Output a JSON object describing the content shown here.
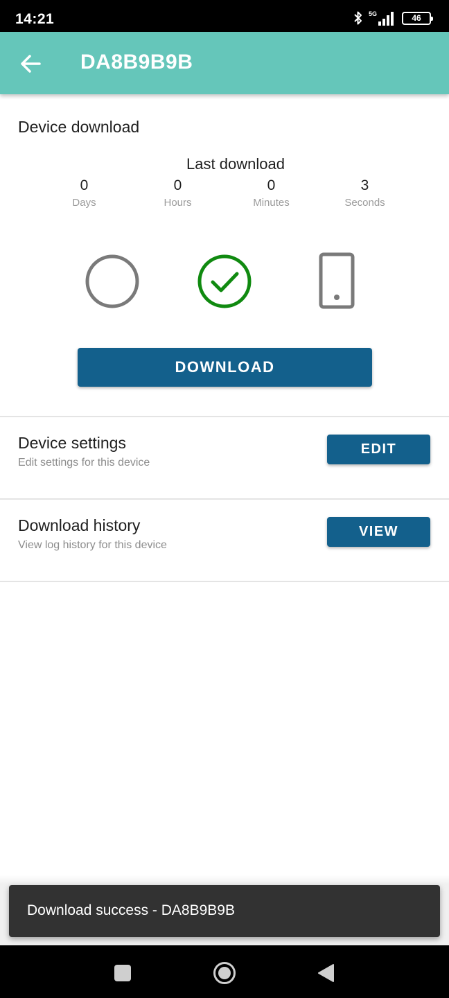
{
  "status_bar": {
    "time": "14:21",
    "network": "5G",
    "battery": "46"
  },
  "app_bar": {
    "title": "DA8B9B9B"
  },
  "device_download": {
    "title": "Device download",
    "last_download_label": "Last download",
    "timer": [
      {
        "value": "0",
        "label": "Days"
      },
      {
        "value": "0",
        "label": "Hours"
      },
      {
        "value": "0",
        "label": "Minutes"
      },
      {
        "value": "3",
        "label": "Seconds"
      }
    ],
    "download_button": "DOWNLOAD"
  },
  "device_settings": {
    "title": "Device settings",
    "subtitle": "Edit settings for this device",
    "button": "EDIT"
  },
  "download_history": {
    "title": "Download history",
    "subtitle": "View log history for this device",
    "button": "VIEW"
  },
  "snackbar": {
    "message": "Download success - DA8B9B9B"
  },
  "colors": {
    "app_bar": "#65c6ba",
    "primary_button": "#13608c",
    "success": "#108a10",
    "neutral_icon": "#7a7a7a"
  },
  "icons": {
    "back": "arrow-left-icon",
    "idle": "circle-outline-icon",
    "success": "check-circle-icon",
    "device": "smartphone-icon"
  }
}
